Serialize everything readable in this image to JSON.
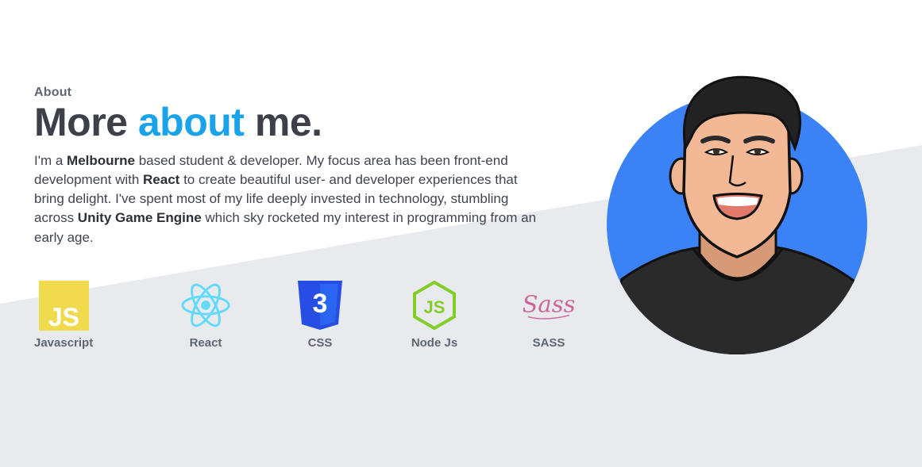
{
  "section": {
    "eyebrow": "About",
    "headline_part1": "More",
    "headline_accent": "about",
    "headline_part2": "me."
  },
  "bio": {
    "t1": "I'm a ",
    "b1": "Melbourne",
    "t2": " based student & developer. My focus area has been front-end development with ",
    "b2": "React",
    "t3": " to create beautiful user- and developer experiences that bring delight. I've spent most of my life deeply invested in technology, stumbling across ",
    "b3": "Unity Game Engine",
    "t4": " which sky rocketed my interest in programming from an early age."
  },
  "skills": [
    {
      "label": "Javascript",
      "icon": "javascript-icon"
    },
    {
      "label": "React",
      "icon": "react-icon"
    },
    {
      "label": "CSS",
      "icon": "css-icon"
    },
    {
      "label": "Node Js",
      "icon": "nodejs-icon"
    },
    {
      "label": "SASS",
      "icon": "sass-icon"
    }
  ],
  "colors": {
    "accent": "#1aa3ea",
    "background_slant": "#e8eaed",
    "avatar_circle": "#3b82f6"
  }
}
